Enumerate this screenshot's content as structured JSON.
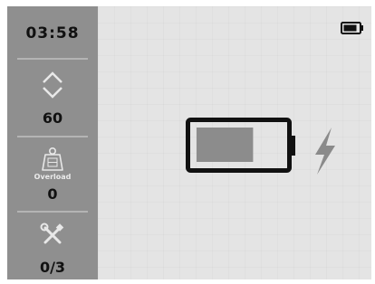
{
  "sidebar": {
    "timer": "03:58",
    "level_icon": "up-down-arrows-icon",
    "level_value": "60",
    "weight_icon": "weight-icon",
    "weight_label": "Overload",
    "weight_value": "0",
    "tools_icon": "tools-icon",
    "tools_value": "0/3"
  },
  "status": {
    "battery_icon": "battery-icon"
  },
  "main": {
    "charging_icon": "battery-charging-icon",
    "bolt_icon": "lightning-bolt-icon",
    "charge_level": 0.65
  },
  "colors": {
    "sidebar_bg": "#8f8f8f",
    "screen_bg": "#e2e2e2",
    "battery_fill": "#8c8c8c",
    "outline": "#111111",
    "bolt": "#8a8a8a"
  }
}
